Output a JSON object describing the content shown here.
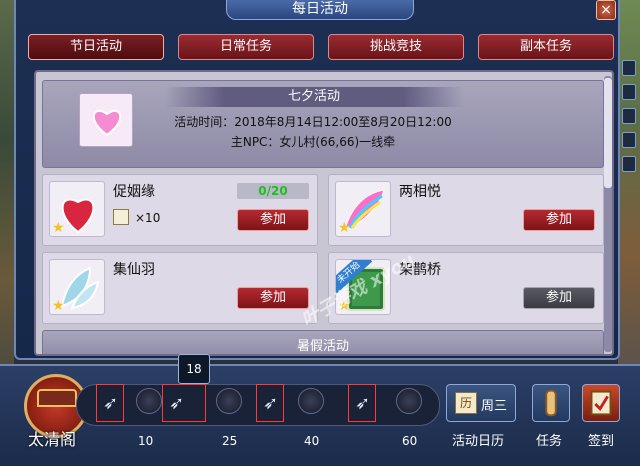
{
  "window": {
    "title": "每日活动",
    "close_label": "×"
  },
  "tabs": [
    {
      "label": "节日活动",
      "active": true
    },
    {
      "label": "日常任务",
      "active": false
    },
    {
      "label": "挑战竞技",
      "active": false
    },
    {
      "label": "副本任务",
      "active": false
    }
  ],
  "event": {
    "title": "七夕活动",
    "time_line": "活动时间：2018年8月14日12:00至8月20日12:00",
    "npc_line": "主NPC：女儿村(66,66)一线牵"
  },
  "activities": [
    {
      "name": "促姻缘",
      "progress": "0/20",
      "item_count": "×10",
      "button": "参加",
      "state": "active"
    },
    {
      "name": "两相悦",
      "button": "参加",
      "state": "active"
    },
    {
      "name": "集仙羽",
      "button": "参加",
      "state": "active"
    },
    {
      "name": "架鹊桥",
      "ribbon": "未开始",
      "button": "参加",
      "state": "disabled"
    }
  ],
  "section2": {
    "title": "暑假活动"
  },
  "watermark": "叶子游戏 xyou",
  "bottom": {
    "tower_label": "太清阁",
    "tooltip": "18",
    "milestones": [
      "10",
      "25",
      "40",
      "60"
    ],
    "calendar": {
      "icon_char": "历",
      "text": "周三",
      "label": "活动日历"
    },
    "task_label": "任务",
    "signin_label": "签到"
  },
  "colors": {
    "accent_red": "#9a2b32",
    "panel": "#c9c6d4",
    "window_blue": "#1d2f52",
    "progress_green": "#1ec01e"
  }
}
